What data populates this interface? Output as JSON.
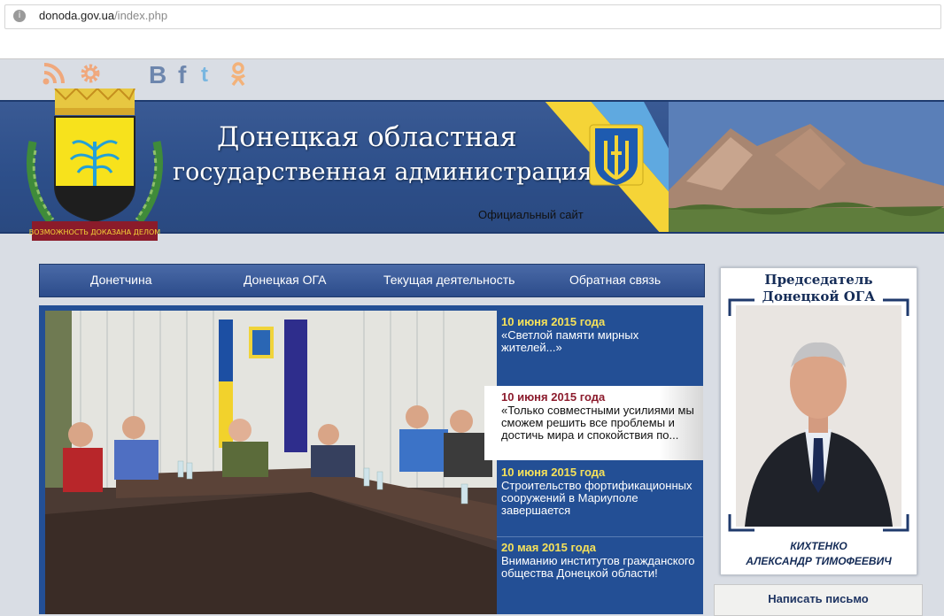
{
  "browser": {
    "url_domain": "donoda.gov.ua",
    "url_path": "/index.php"
  },
  "social": {
    "icons": [
      "rss-icon",
      "settings-icon",
      "vk-icon",
      "facebook-icon",
      "twitter-icon",
      "odnoklassniki-icon"
    ]
  },
  "header": {
    "title_line1": "Донецкая областная",
    "title_line2": "государственная администрация",
    "subtitle": "Официальный сайт",
    "coat_motto": "ВОЗМОЖНОСТЬ ДОКАЗАНА ДЕЛОМ"
  },
  "nav": [
    {
      "label": "Донетчина"
    },
    {
      "label": "Донецкая ОГА"
    },
    {
      "label": "Текущая деятельность"
    },
    {
      "label": "Обратная связь"
    }
  ],
  "news": [
    {
      "date": "10 июня 2015 года",
      "text": "«Светлой памяти мирных жителей...»"
    },
    {
      "date": "10 июня 2015 года",
      "text": "«Только совместными усилиями мы сможем решить все проблемы и достичь мира и спокойствия по..."
    },
    {
      "date": "10 июня 2015 года",
      "text": "Строительство фортификационных сооружений в Мариуполе завершается"
    },
    {
      "date": "20 мая 2015 года",
      "text": "Вниманию институтов гражданского общества Донецкой области!"
    }
  ],
  "chairman": {
    "title_line1": "Председатель",
    "title_line2": "Донецкой ОГА",
    "name_line1": "КИХТЕНКО",
    "name_line2": "АЛЕКСАНДР ТИМОФЕЕВИЧ"
  },
  "write_letter": {
    "label": "Написать письмо"
  },
  "colors": {
    "banner": "#2d4f8a",
    "nav": "#3a5c9a",
    "news_date": "#f5e15a",
    "active_date": "#8c1c2d"
  }
}
